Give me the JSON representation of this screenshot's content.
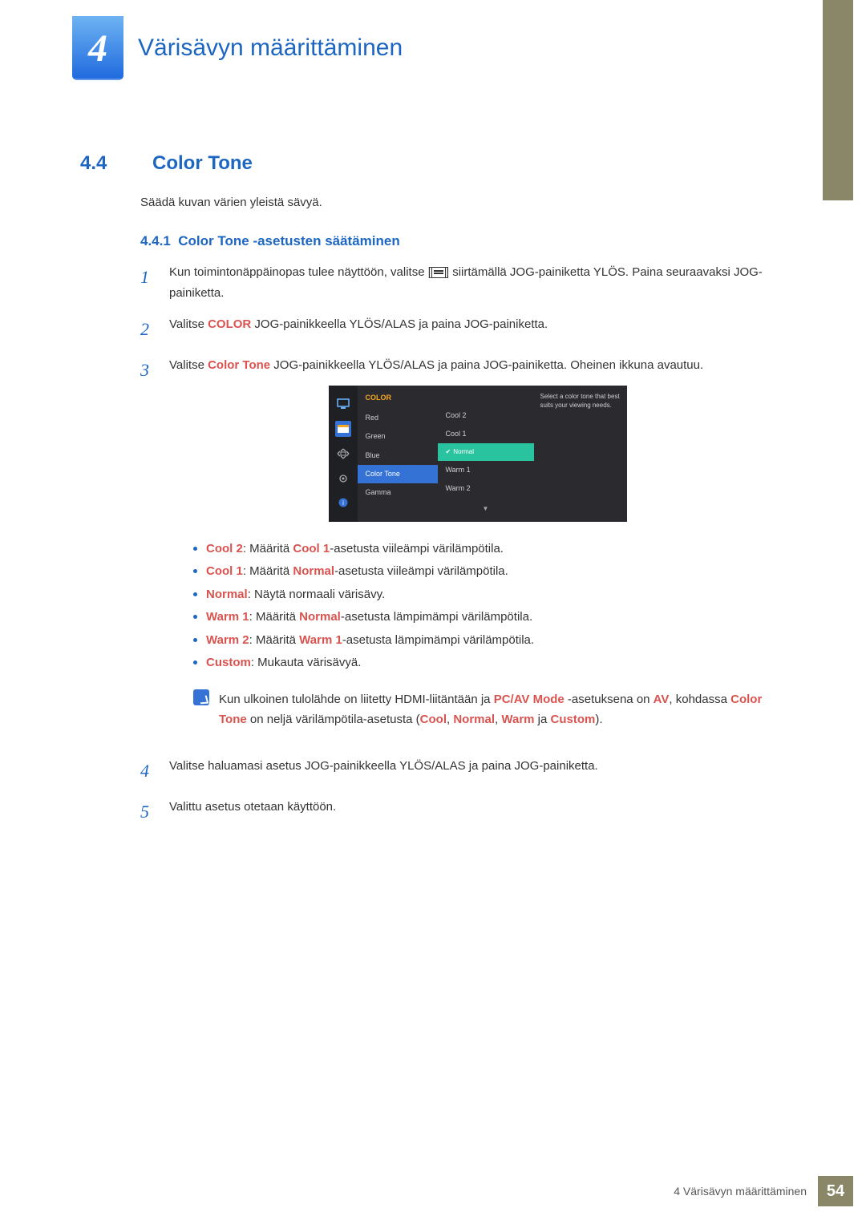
{
  "chapter": {
    "number": "4",
    "title": "Värisävyn määrittäminen"
  },
  "section": {
    "number": "4.4",
    "title": "Color Tone"
  },
  "intro": "Säädä kuvan värien yleistä sävyä.",
  "subsection": {
    "number": "4.4.1",
    "title": "Color Tone -asetusten säätäminen"
  },
  "steps": {
    "s1": {
      "num": "1",
      "pre": "Kun toimintonäppäinopas tulee näyttöön, valitse [",
      "post": "] siirtämällä JOG-painiketta YLÖS. Paina seuraavaksi JOG-painiketta."
    },
    "s2": {
      "num": "2",
      "pre": "Valitse ",
      "hl": "COLOR",
      "post": " JOG-painikkeella YLÖS/ALAS ja paina JOG-painiketta."
    },
    "s3": {
      "num": "3",
      "pre": "Valitse ",
      "hl": "Color Tone",
      "post": " JOG-painikkeella YLÖS/ALAS ja paina JOG-painiketta. Oheinen ikkuna avautuu."
    },
    "s4": {
      "num": "4",
      "text": "Valitse haluamasi asetus JOG-painikkeella YLÖS/ALAS ja paina JOG-painiketta."
    },
    "s5": {
      "num": "5",
      "text": "Valittu asetus otetaan käyttöön."
    }
  },
  "osd": {
    "header": "COLOR",
    "menu": {
      "red": "Red",
      "green": "Green",
      "blue": "Blue",
      "colortone": "Color Tone",
      "gamma": "Gamma"
    },
    "options": {
      "cool2": "Cool 2",
      "cool1": "Cool 1",
      "normal": "Normal",
      "warm1": "Warm 1",
      "warm2": "Warm 2"
    },
    "desc": "Select a color tone that best suits your viewing needs."
  },
  "bullets": {
    "b1": {
      "hl": "Cool 2",
      "mid": ": Määritä ",
      "hl2": "Cool 1",
      "rest": "-asetusta viileämpi värilämpötila."
    },
    "b2": {
      "hl": "Cool 1",
      "mid": ": Määritä ",
      "hl2": "Normal",
      "rest": "-asetusta viileämpi värilämpötila."
    },
    "b3": {
      "hl": "Normal",
      "rest": ": Näytä normaali värisävy."
    },
    "b4": {
      "hl": "Warm 1",
      "mid": ": Määritä ",
      "hl2": "Normal",
      "rest": "-asetusta lämpimämpi värilämpötila."
    },
    "b5": {
      "hl": "Warm 2",
      "mid": ": Määritä ",
      "hl2": "Warm 1",
      "rest": "-asetusta lämpimämpi värilämpötila."
    },
    "b6": {
      "hl": "Custom",
      "rest": ": Mukauta värisävyä."
    }
  },
  "note": {
    "l1a": "Kun ulkoinen tulolähde on liitetty HDMI-liitäntään ja ",
    "l1h1": "PC/AV Mode",
    "l1b": " -asetuksena on ",
    "l1h2": "AV",
    "l1c": ", kohdassa ",
    "l2h1": "Color Tone",
    "l2a": " on neljä värilämpötila-asetusta (",
    "l2h2": "Cool",
    "l2h3": "Normal",
    "l2h4": "Warm",
    "l2b": " ja ",
    "l2h5": "Custom",
    "l2c": ")."
  },
  "footer": {
    "text": "4 Värisävyn määrittäminen",
    "page": "54"
  }
}
